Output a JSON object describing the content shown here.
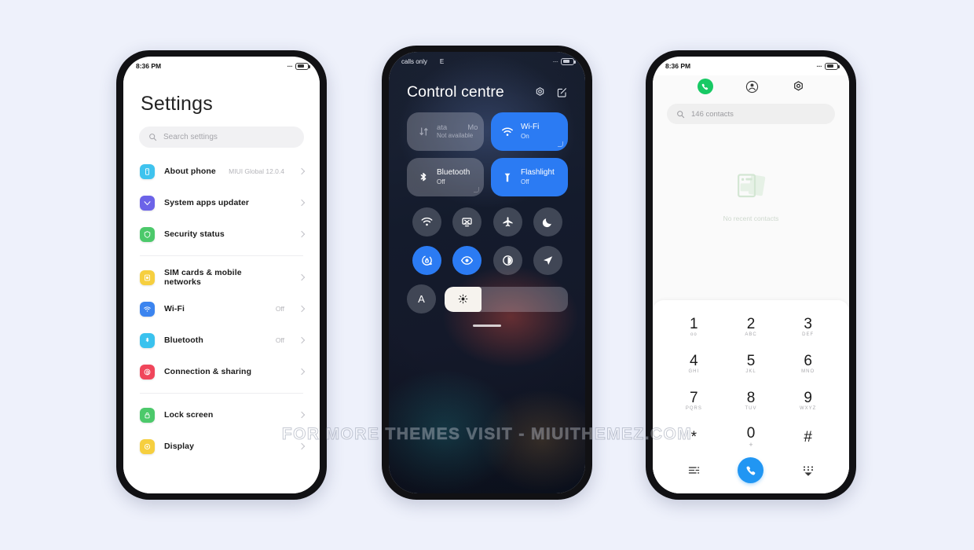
{
  "page": {
    "background_color": "#eef1fb",
    "watermark": "FOR MORE THEMES VISIT - MIUITHEMEZ.COM"
  },
  "settings_phone": {
    "statusbar": {
      "time": "8:36 PM",
      "signal": "····",
      "battery": "87"
    },
    "title": "Settings",
    "search": {
      "placeholder": "Search settings",
      "icon": "search-icon"
    },
    "groups": [
      {
        "items": [
          {
            "label": "About phone",
            "value": "MIUI Global 12.0.4",
            "icon": "about-phone-icon",
            "color": "#3fc3ee"
          },
          {
            "label": "System apps updater",
            "value": "",
            "icon": "system-apps-updater-icon",
            "color": "#6c63e8"
          },
          {
            "label": "Security status",
            "value": "",
            "icon": "security-status-icon",
            "color": "#4cc96b"
          }
        ]
      },
      {
        "items": [
          {
            "label": "SIM cards & mobile networks",
            "value": "",
            "icon": "sim-card-icon",
            "color": "#f6cf3f"
          },
          {
            "label": "Wi-Fi",
            "value": "Off",
            "icon": "wifi-icon",
            "color": "#3b84ef"
          },
          {
            "label": "Bluetooth",
            "value": "Off",
            "icon": "bluetooth-icon",
            "color": "#3ac2ee"
          },
          {
            "label": "Connection & sharing",
            "value": "",
            "icon": "connection-sharing-icon",
            "color": "#f0465b"
          }
        ]
      },
      {
        "items": [
          {
            "label": "Lock screen",
            "value": "",
            "icon": "lock-screen-icon",
            "color": "#4cc96b"
          },
          {
            "label": "Display",
            "value": "",
            "icon": "display-icon",
            "color": "#f6cf3f"
          }
        ]
      }
    ]
  },
  "control_centre_phone": {
    "statusbar": {
      "carrier": "calls only",
      "network": "E",
      "signal": "····",
      "battery": "87"
    },
    "title": "Control centre",
    "header_icons": [
      {
        "name": "settings-gear-icon"
      },
      {
        "name": "edit-icon"
      }
    ],
    "tiles": [
      {
        "id": "mobile-data",
        "name_left": "ata",
        "name_right": "Mo",
        "sub": "Not available",
        "state": "unavailable",
        "icon": "mobile-data-icon"
      },
      {
        "id": "wifi",
        "name": "Wi-Fi",
        "sub": "On",
        "state": "on",
        "icon": "wifi-icon"
      },
      {
        "id": "bluetooth",
        "name": "Bluetooth",
        "sub": "Off",
        "state": "off",
        "icon": "bluetooth-icon"
      },
      {
        "id": "flashlight",
        "name": "Flashlight",
        "sub": "Off",
        "state": "on",
        "icon": "flashlight-icon"
      }
    ],
    "toggles": [
      {
        "name": "hotspot-icon",
        "active": false
      },
      {
        "name": "cast-icon",
        "active": false
      },
      {
        "name": "airplane-mode-icon",
        "active": false
      },
      {
        "name": "dark-mode-icon",
        "active": false
      },
      {
        "name": "auto-rotate-lock-icon",
        "active": true
      },
      {
        "name": "reading-mode-icon",
        "active": true
      },
      {
        "name": "contrast-icon",
        "active": false
      },
      {
        "name": "location-icon",
        "active": false
      }
    ],
    "brightness": {
      "auto_label": "A",
      "icon": "brightness-icon",
      "level_percent": 30
    },
    "accent_on": "#2b7bf3"
  },
  "dialer_phone": {
    "statusbar": {
      "time": "8:36 PM",
      "signal": "····",
      "battery": "87"
    },
    "tabs": [
      {
        "name": "dialpad-tab",
        "icon": "phone-icon",
        "active": true
      },
      {
        "name": "contacts-tab",
        "icon": "contacts-icon",
        "active": false
      },
      {
        "name": "settings-tab",
        "icon": "gear-icon",
        "active": false
      }
    ],
    "search": {
      "text": "146 contacts",
      "icon": "search-icon"
    },
    "empty_state": {
      "text": "No recent contacts",
      "icon": "no-contacts-icon"
    },
    "keypad": [
      {
        "num": "1",
        "sub": "oo"
      },
      {
        "num": "2",
        "sub": "ABC"
      },
      {
        "num": "3",
        "sub": "DEF"
      },
      {
        "num": "4",
        "sub": "GHI"
      },
      {
        "num": "5",
        "sub": "JKL"
      },
      {
        "num": "6",
        "sub": "MNO"
      },
      {
        "num": "7",
        "sub": "PQRS"
      },
      {
        "num": "8",
        "sub": "TUV"
      },
      {
        "num": "9",
        "sub": "WXYZ"
      },
      {
        "num": "*",
        "sub": ""
      },
      {
        "num": "0",
        "sub": "+"
      },
      {
        "num": "#",
        "sub": ""
      }
    ],
    "actions": [
      {
        "name": "dial-options-icon"
      },
      {
        "name": "call-button",
        "color": "#2196f3"
      },
      {
        "name": "hide-keypad-icon"
      }
    ]
  }
}
